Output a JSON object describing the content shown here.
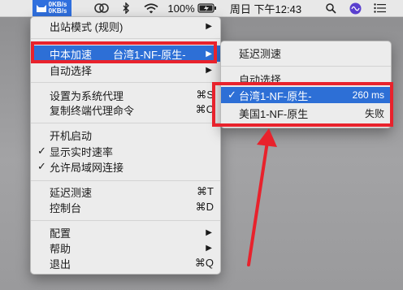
{
  "menubar": {
    "speed_up": "0KB/s",
    "speed_down": "0KB/s",
    "battery": "100%",
    "clock": "周日 下午12:43"
  },
  "main_menu": {
    "outbound_mode": "出站模式 (规则)",
    "proxy_group": "中本加速",
    "proxy_group_value": "台湾1-NF-原生-",
    "auto_select": "自动选择",
    "set_system_proxy": "设置为系统代理",
    "set_system_proxy_shortcut": "⌘S",
    "copy_terminal_cmd": "复制终端代理命令",
    "copy_terminal_cmd_shortcut": "⌘C",
    "launch_at_login": "开机启动",
    "show_speed": "显示实时速率",
    "allow_lan": "允许局域网连接",
    "latency_test": "延迟测速",
    "latency_test_shortcut": "⌘T",
    "dashboard": "控制台",
    "dashboard_shortcut": "⌘D",
    "config": "配置",
    "help": "帮助",
    "quit": "退出",
    "quit_shortcut": "⌘Q"
  },
  "sub_menu": {
    "latency_test": "延迟测速",
    "auto_select": "自动选择",
    "nodes": [
      {
        "name": "台湾1-NF-原生-",
        "latency": "260 ms",
        "selected": true
      },
      {
        "name": "美国1-NF-原生",
        "latency": "失败",
        "selected": false
      }
    ]
  },
  "colors": {
    "highlight": "#2d6fd6",
    "annotation": "#e8222c"
  }
}
